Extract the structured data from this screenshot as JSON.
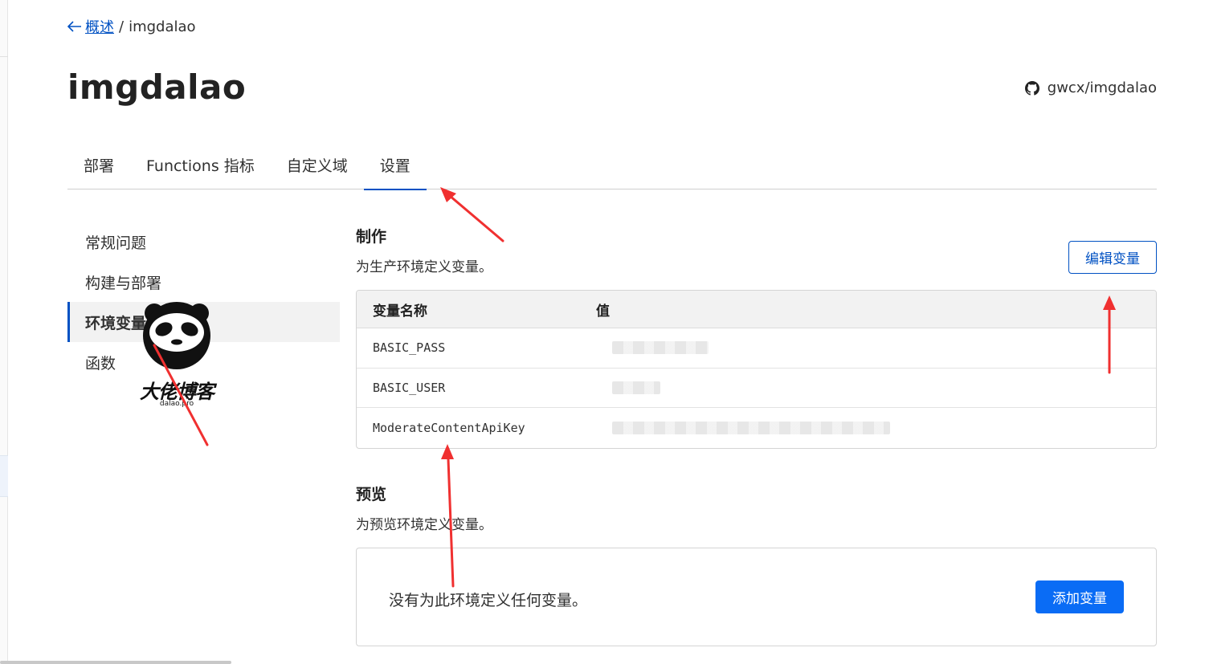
{
  "breadcrumb": {
    "back_label": "概述",
    "separator": "/",
    "current": "imgdalao"
  },
  "project": {
    "title": "imgdalao",
    "repo": "gwcx/imgdalao"
  },
  "tabs": [
    {
      "label": "部署"
    },
    {
      "label": "Functions 指标"
    },
    {
      "label": "自定义域"
    },
    {
      "label": "设置"
    }
  ],
  "side_nav": [
    {
      "label": "常规问题"
    },
    {
      "label": "构建与部署"
    },
    {
      "label": "环境变量"
    },
    {
      "label": "函数"
    }
  ],
  "production": {
    "title": "制作",
    "description": "为生产环境定义变量。",
    "edit_button": "编辑变量",
    "table": {
      "headers": {
        "name": "变量名称",
        "value": "值"
      },
      "rows": [
        {
          "name": "BASIC_PASS"
        },
        {
          "name": "BASIC_USER"
        },
        {
          "name": "ModerateContentApiKey"
        }
      ]
    }
  },
  "preview": {
    "title": "预览",
    "description": "为预览环境定义变量。",
    "empty_text": "没有为此环境定义任何变量。",
    "add_button": "添加变量"
  },
  "watermark": {
    "text": "大佬博客",
    "sub": "dalao.pro"
  },
  "colors": {
    "link": "#0051c3",
    "primary_button": "#0a6cf5",
    "annotation_arrow": "#f03030"
  },
  "icons": {
    "back": "arrow-left-icon",
    "repo": "github-icon"
  }
}
